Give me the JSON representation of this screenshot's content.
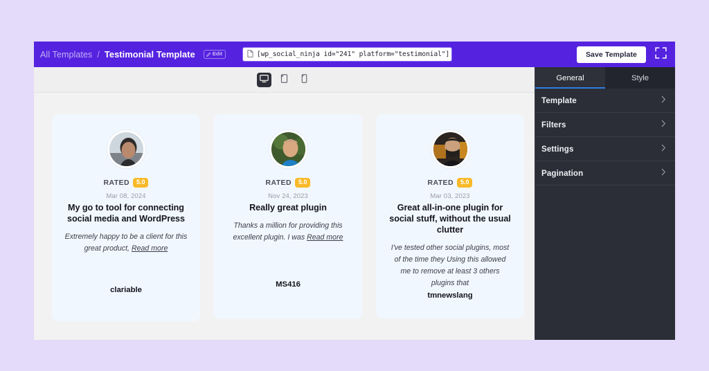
{
  "topbar": {
    "breadcrumb_root": "All Templates",
    "breadcrumb_separator": "/",
    "breadcrumb_current": "Testimonial Template",
    "edit_badge": "Edit",
    "shortcode": "[wp_social_ninja id=\"241\" platform=\"testimonial\"]",
    "save_label": "Save Template",
    "bar_color": "#5522e0"
  },
  "device_bar": {
    "devices": [
      {
        "name": "desktop",
        "active": true
      },
      {
        "name": "tablet",
        "active": false
      },
      {
        "name": "mobile",
        "active": false
      }
    ]
  },
  "cards": [
    {
      "rated_label": "RATED",
      "rating": "5.0",
      "date": "Mar 08, 2024",
      "title": "My go to tool for connecting social media and WordPress",
      "body": "Extremely happy to be a client for this great product,",
      "read_more": "Read more",
      "author": "clariable"
    },
    {
      "rated_label": "RATED",
      "rating": "5.0",
      "date": "Nov 24, 2023",
      "title": "Really great plugin",
      "body": "Thanks a million for providing this excellent plugin. I was",
      "read_more": "Read more",
      "author": "MS416"
    },
    {
      "rated_label": "RATED",
      "rating": "5.0",
      "date": "Mar 03, 2023",
      "title": "Great all-in-one plugin for social stuff, without the usual clutter",
      "body": "I've tested other social plugins, most of the time they Using this allowed me to remove at least 3 others plugins that",
      "read_more": "",
      "author": "tmnewslang"
    }
  ],
  "sidebar": {
    "tabs": [
      {
        "label": "General",
        "active": true
      },
      {
        "label": "Style",
        "active": false
      }
    ],
    "rows": [
      {
        "label": "Template"
      },
      {
        "label": "Filters"
      },
      {
        "label": "Settings"
      },
      {
        "label": "Pagination"
      }
    ],
    "accent_color": "#2f7fe0"
  },
  "colors": {
    "page_background": "#e4daf9",
    "rating_pill": "#f9b928",
    "card_background": "#f1f7fe",
    "sidebar_background": "#2b2d37"
  }
}
